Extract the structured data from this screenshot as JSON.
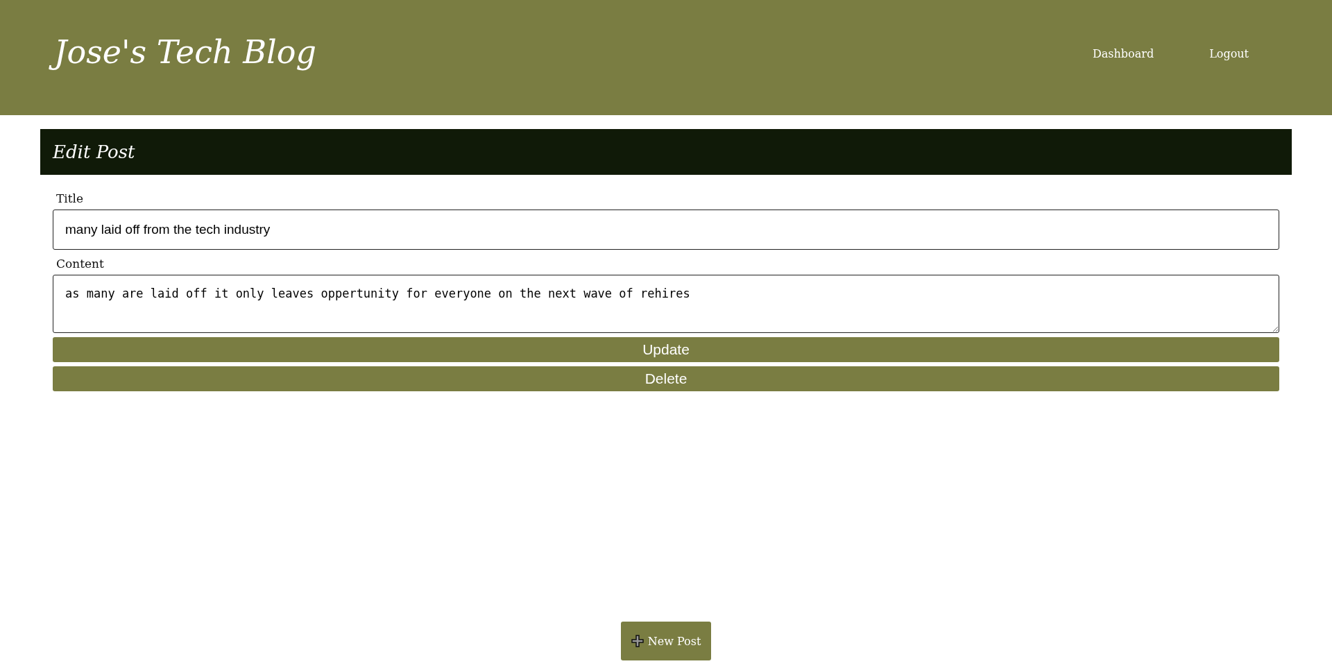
{
  "header": {
    "title": "Jose's Tech Blog",
    "nav": [
      "Dashboard",
      "Logout"
    ]
  },
  "panel": {
    "title": "Edit Post"
  },
  "form": {
    "title_label": "Title",
    "title_value": "many laid off from the tech industry",
    "content_label": "Content",
    "content_value": "as many are laid off it only leaves oppertunity for everyone on the next wave of rehires",
    "buttons": [
      "Update",
      "Delete"
    ]
  },
  "new_post": {
    "label": "New Post"
  }
}
